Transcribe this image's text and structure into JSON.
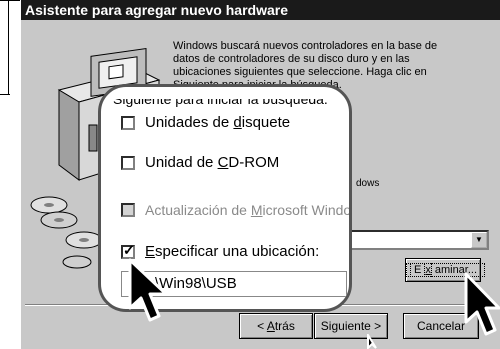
{
  "window": {
    "title": "Asistente para agregar nuevo hardware"
  },
  "description": "Windows buscará nuevos controladores en la base de datos de controladores de su disco duro y en las ubicaciones siguientes que seleccione. Haga clic en Siguiente para iniciar la búsqueda.",
  "partial_under_bubble": {
    "heading": "Siguiente para iniciar la búsqueda.",
    "right_fragment": "dows"
  },
  "options": [
    {
      "pre": "Unidades de ",
      "key": "d",
      "post": "isquete",
      "checked": false,
      "enabled": true
    },
    {
      "pre": "Unidad de ",
      "key": "C",
      "post": "D-ROM",
      "checked": false,
      "enabled": true
    },
    {
      "pre": "Actualización de ",
      "key": "M",
      "post": "icrosoft Windows",
      "checked": false,
      "enabled": false
    },
    {
      "pre": "",
      "key": "E",
      "post": "specificar una ubicación:",
      "checked": true,
      "enabled": true
    }
  ],
  "location_value": "C:\\Win98\\USB",
  "browse": {
    "pre": "E",
    "key": "x",
    "post": "aminar..."
  },
  "nav": {
    "back": {
      "pre": "< ",
      "key": "A",
      "post": "trás"
    },
    "next": "Siguiente >",
    "cancel": "Cancelar"
  },
  "icons": [
    "computer-icon",
    "cd-disc-icon",
    "mouse-cursor-icon",
    "dropdown-arrow-icon",
    "checkmark-icon"
  ],
  "colors": {
    "titlebar": "#1a1a1a",
    "dialog": "#c8c8c8",
    "disabled_text": "#8a8a8a"
  }
}
